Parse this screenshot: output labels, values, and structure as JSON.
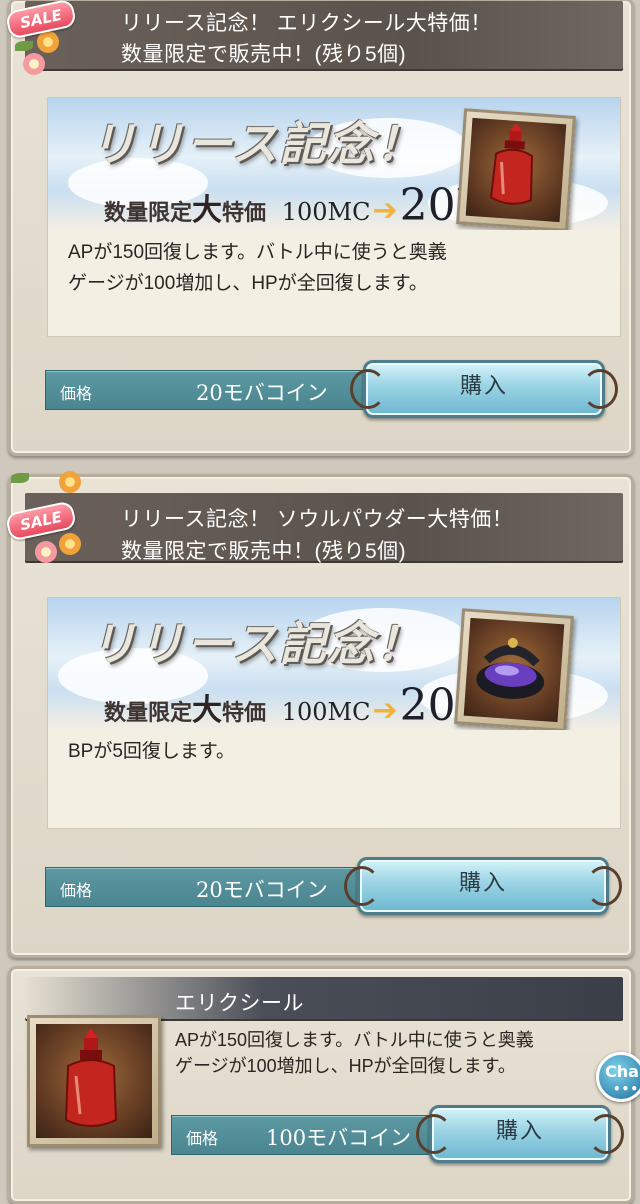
{
  "offers": [
    {
      "badge": "SALE",
      "title_line1": "リリース記念！ エリクシール大特価！",
      "title_line2": "数量限定で販売中！(残り5個)",
      "banner_title": "リリース記念！",
      "banner_sub_label_a": "数量限定",
      "banner_sub_label_big": "大",
      "banner_sub_label_b": "特価",
      "banner_old_price": "100MC",
      "banner_new_price": "20MC",
      "desc_line1": "APが150回復します。バトル中に使うと奥義",
      "desc_line2": "ゲージが100増加し、HPが全回復します。",
      "price_label": "価格",
      "price_value": "20モバコイン",
      "buy_label": "購入",
      "item_icon": "elixir-bottle-icon"
    },
    {
      "badge": "SALE",
      "title_line1": "リリース記念！ ソウルパウダー大特価！",
      "title_line2": "数量限定で販売中！(残り5個)",
      "banner_title": "リリース記念！",
      "banner_sub_label_a": "数量限定",
      "banner_sub_label_big": "大",
      "banner_sub_label_b": "特価",
      "banner_old_price": "100MC",
      "banner_new_price": "20MC",
      "desc_line1": "BPが5回復します。",
      "price_label": "価格",
      "price_value": "20モバコイン",
      "buy_label": "購入",
      "item_icon": "soul-powder-icon"
    }
  ],
  "item": {
    "name": "エリクシール",
    "desc_line1": "APが150回復します。バトル中に使うと奥義",
    "desc_line2": "ゲージが100増加し、HPが全回復します。",
    "price_label": "価格",
    "price_value": "100モバコイン",
    "buy_label": "購入",
    "item_icon": "elixir-bottle-icon"
  },
  "chat": {
    "label": "Cha",
    "dots": "•••"
  }
}
